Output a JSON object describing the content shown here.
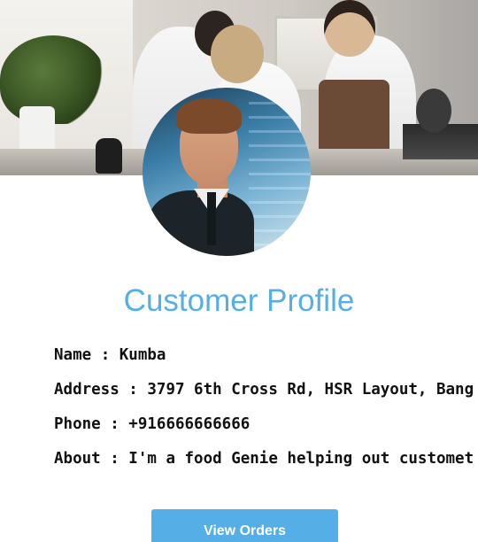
{
  "cover": {
    "image": "kitchen-staff-photo"
  },
  "avatar": {
    "image": "customer-portrait-photo"
  },
  "profile": {
    "title": "Customer Profile",
    "fields": [
      {
        "label": "Name",
        "value": "Kumba"
      },
      {
        "label": "Address",
        "value": "3797 6th Cross Rd, HSR Layout, Bang"
      },
      {
        "label": "Phone",
        "value": "+916666666666"
      },
      {
        "label": "About",
        "value": "I'm a food Genie helping out customet"
      }
    ],
    "separator": " : "
  },
  "actions": {
    "view_orders_label": "View Orders"
  },
  "colors": {
    "accent": "#56aee6",
    "text": "#111111",
    "background": "#ffffff"
  }
}
